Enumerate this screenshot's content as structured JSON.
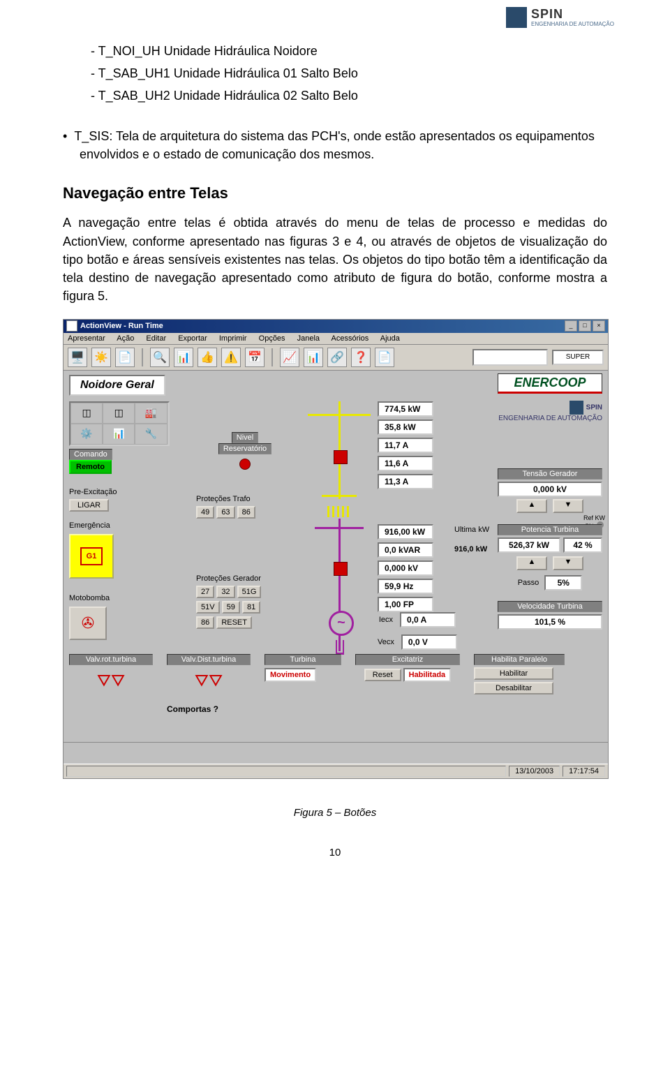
{
  "headerBrand": {
    "name": "SPIN",
    "sub": "ENGENHARIA DE AUTOMAÇÃO"
  },
  "dashList": [
    "T_NOI_UH Unidade Hidráulica Noidore",
    "T_SAB_UH1 Unidade Hidráulica 01 Salto Belo",
    "T_SAB_UH2 Unidade Hidráulica 02 Salto Belo"
  ],
  "bullet": "T_SIS: Tela de arquitetura do sistema das PCH's, onde estão apresentados os equipamentos envolvidos e o estado de comunicação dos mesmos.",
  "secTitle": "Navegação entre Telas",
  "para": "A navegação entre telas é obtida através do menu de telas de processo e medidas do ActionView, conforme apresentado nas figuras 3 e 4, ou através de objetos de visualização do tipo botão e áreas sensíveis existentes nas telas. Os objetos do tipo botão têm a identificação da tela destino de navegação apresentado como atributo de figura do botão, conforme mostra a figura 5.",
  "app": {
    "title": "ActionView - Run Time",
    "menu": [
      "Apresentar",
      "Ação",
      "Editar",
      "Exportar",
      "Imprimir",
      "Opções",
      "Janela",
      "Acessórios",
      "Ajuda"
    ],
    "toolbarIcons": [
      "🖥️",
      "☀️",
      "📄",
      "🔍",
      "📊",
      "👍",
      "⚠️",
      "📅",
      "📈",
      "📊",
      "🔗",
      "❓",
      "📄"
    ],
    "user": "",
    "role": "SUPER",
    "screenTitle": "Noidore Geral",
    "navGlyphs": [
      "◫",
      "◫",
      "🏭",
      "⚙️",
      "📊",
      "🔧"
    ],
    "comando": {
      "label": "Comando",
      "value": "Remoto"
    },
    "preexc": {
      "label": "Pre-Excitação",
      "btn": "LIGAR"
    },
    "emerg": {
      "label": "Emergência",
      "tag": "G1"
    },
    "moto": {
      "label": "Motobomba"
    },
    "nivel": {
      "label1": "Nivel",
      "label2": "Reservatório"
    },
    "trafo": {
      "label": "Proteções Trafo",
      "btns": [
        "49",
        "63",
        "86"
      ]
    },
    "ger": {
      "label": "Proteções Gerador",
      "btns": [
        "27",
        "32",
        "51G",
        "51V",
        "59",
        "81",
        "86",
        "RESET"
      ]
    },
    "vals1": [
      "774,5 kW",
      "35,8 kW",
      "11,7 A",
      "11,6 A",
      "11,3 A"
    ],
    "vals2": [
      "916,00 kW",
      "0,0 kVAR",
      "0,000 kV",
      "59,9 Hz",
      "1,00 FP"
    ],
    "iecx": {
      "l1": "Iecx",
      "v1": "0,0 A",
      "l2": "Vecx",
      "v2": "0,0 V"
    },
    "ukw": {
      "l1": "Ultima kW",
      "l2": "916,0 kW"
    },
    "enercoop": "ENERCOOP",
    "tensao": {
      "label": "Tensão Gerador",
      "value": "0,000 kV"
    },
    "pot": {
      "label": "Potencia Turbina",
      "value": "526,37 kW",
      "pct": "42 %"
    },
    "passo": {
      "label": "Passo",
      "value": "5%"
    },
    "vel": {
      "label": "Velocidade Turbina",
      "value": "101,5 %"
    },
    "refkw": {
      "label": "Ref KW",
      "value": "5%"
    },
    "bottom": {
      "valvrot": "Valv.rot.turbina",
      "valvdist": "Valv.Dist.turbina",
      "comportas": "Comportas ?",
      "turbina": {
        "label": "Turbina",
        "state": "Movimento"
      },
      "excit": {
        "label": "Excitatriz",
        "reset": "Reset",
        "hab": "Habilitada"
      },
      "habpar": {
        "label": "Habilita Paralelo",
        "b1": "Habilitar",
        "b2": "Desabilitar"
      }
    },
    "status": {
      "date": "13/10/2003",
      "time": "17:17:54"
    }
  },
  "figCaption": "Figura 5 – Botões",
  "pageNum": "10"
}
